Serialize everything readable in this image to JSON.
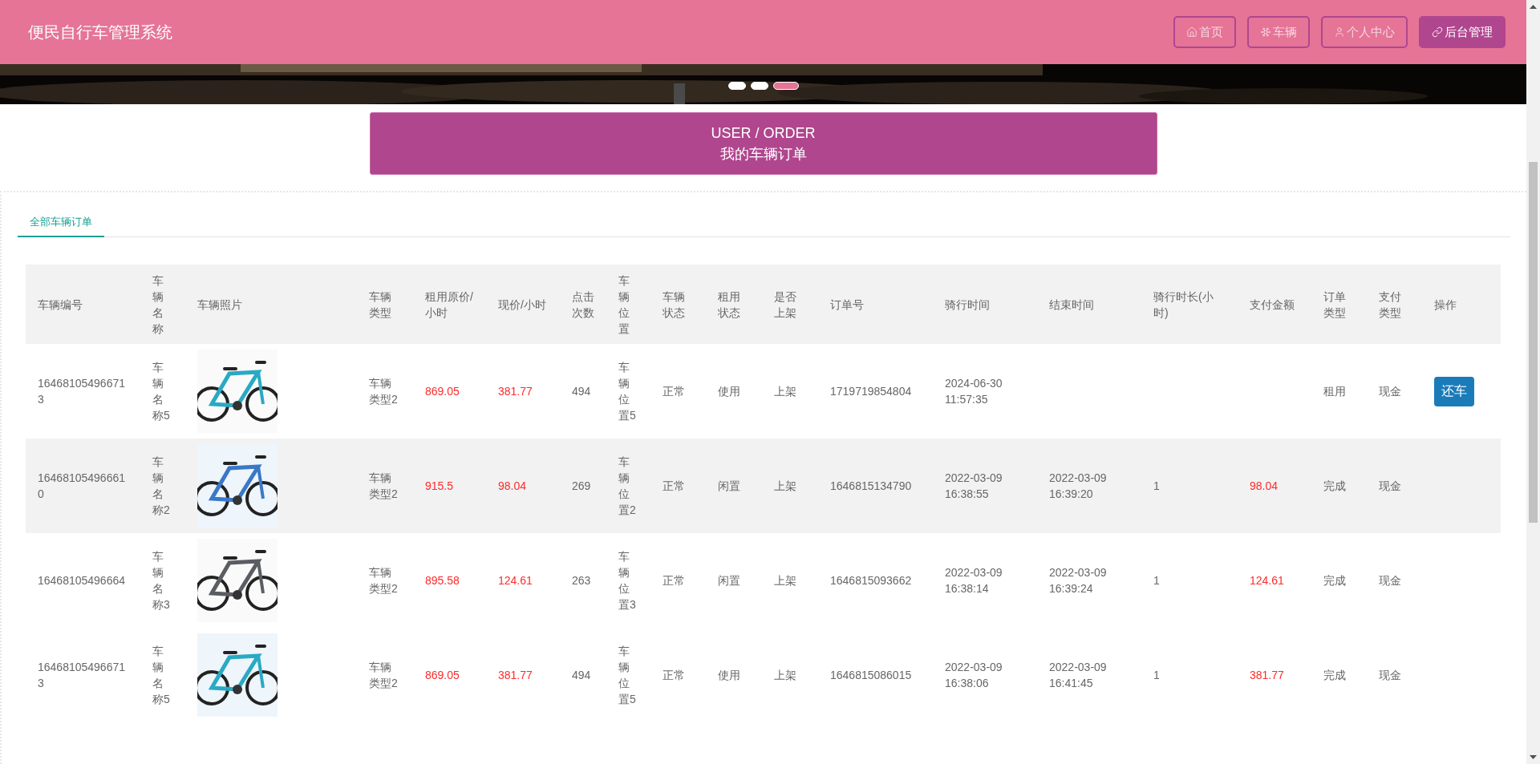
{
  "header": {
    "title": "便民自行车管理系统",
    "nav": [
      {
        "label": "首页",
        "selected": false
      },
      {
        "label": "车辆",
        "selected": false
      },
      {
        "label": "个人中心",
        "selected": false
      },
      {
        "label": "后台管理",
        "selected": true
      }
    ]
  },
  "banner": {
    "kind": "picture",
    "dots": [
      {
        "selected": false
      },
      {
        "selected": false
      },
      {
        "selected": true
      }
    ]
  },
  "section_title": {
    "en": "USER / ORDER",
    "zh": "我的车辆订单"
  },
  "tabs": [
    {
      "label": "全部车辆订单",
      "selected": true
    }
  ],
  "table": {
    "columns": [
      {
        "label": "车辆编号",
        "kind": "text"
      },
      {
        "label": "车辆名称",
        "kind": "text"
      },
      {
        "label": "车辆照片"
      },
      {
        "label": "车辆类型",
        "kind": "text"
      },
      {
        "label": "租用原价/小时",
        "kind": "price"
      },
      {
        "label": "现价/小时",
        "kind": "price"
      },
      {
        "label": "点击次数",
        "kind": "text"
      },
      {
        "label": "车辆位置",
        "kind": "text"
      },
      {
        "label": "车辆状态",
        "kind": "text"
      },
      {
        "label": "租用状态",
        "kind": "text"
      },
      {
        "label": "是否上架",
        "kind": "text"
      },
      {
        "label": "订单号",
        "kind": "text"
      },
      {
        "label": "骑行时间",
        "kind": "text"
      },
      {
        "label": "结束时间",
        "kind": "text"
      },
      {
        "label": "骑行时长(小时)",
        "kind": "text"
      },
      {
        "label": "支付金额",
        "kind": "price"
      },
      {
        "label": "订单类型",
        "kind": "text"
      },
      {
        "label": "支付类型",
        "kind": "text"
      },
      {
        "label": "操作",
        "kind": "action"
      }
    ],
    "rows": [
      {
        "highlighted": false,
        "cells": [
          "164681054966713",
          "车辆名称5",
          {
            "kind": "picture"
          },
          "车辆类型2",
          "869.05",
          "381.77",
          "494",
          "车辆位置5",
          "正常",
          "使用",
          "上架",
          "1719719854804",
          "2024-06-30 11:57:35",
          null,
          null,
          null,
          "租用",
          "现金",
          "还车"
        ]
      },
      {
        "highlighted": true,
        "cells": [
          "164681054966610",
          "车辆名称2",
          {
            "kind": "picture"
          },
          "车辆类型2",
          "915.5",
          "98.04",
          "269",
          "车辆位置2",
          "正常",
          "闲置",
          "上架",
          "1646815134790",
          "2022-03-09 16:38:55",
          "2022-03-09 16:39:20",
          "1",
          "98.04",
          "完成",
          "现金",
          null
        ]
      },
      {
        "highlighted": false,
        "cells": [
          "16468105496664",
          "车辆名称3",
          {
            "kind": "picture"
          },
          "车辆类型2",
          "895.58",
          "124.61",
          "263",
          "车辆位置3",
          "正常",
          "闲置",
          "上架",
          "1646815093662",
          "2022-03-09 16:38:14",
          "2022-03-09 16:39:24",
          "1",
          "124.61",
          "完成",
          "现金",
          null
        ]
      },
      {
        "highlighted": false,
        "cells": [
          "164681054966713",
          "车辆名称5",
          {
            "kind": "picture"
          },
          "车辆类型2",
          "869.05",
          "381.77",
          "494",
          "车辆位置5",
          "正常",
          "使用",
          "上架",
          "1646815086015",
          "2022-03-09 16:38:06",
          "2022-03-09 16:41:45",
          "1",
          "381.77",
          "完成",
          "现金",
          null
        ]
      }
    ]
  }
}
